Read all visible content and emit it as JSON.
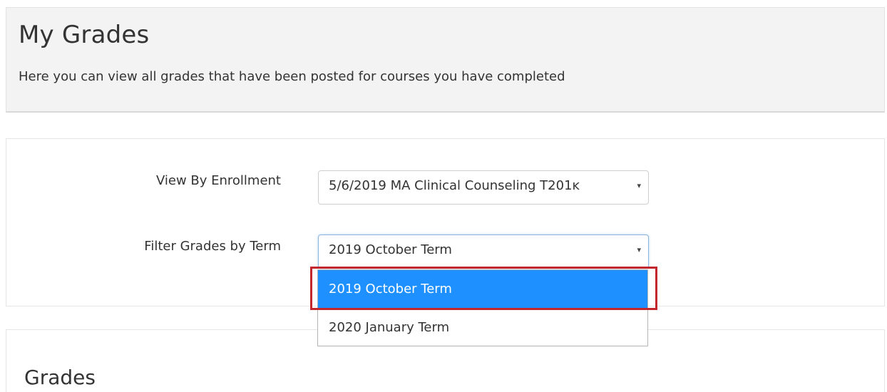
{
  "header": {
    "title": "My Grades",
    "subtitle": "Here you can view all grades that have been posted for courses you have completed"
  },
  "filters": {
    "enrollment": {
      "label": "View By Enrollment",
      "selected": "5/6/2019 MA Clinical Counseling T201ĸ"
    },
    "term": {
      "label": "Filter Grades by Term",
      "selected": "2019 October Term",
      "options": [
        "2019 October Term",
        "2020 January Term"
      ],
      "highlighted_option": "2019 October Term"
    },
    "caret_glyph": "▾"
  },
  "grades": {
    "title": "Grades"
  },
  "colors": {
    "header_bg": "#f3f3f3",
    "selected_option_bg": "#1e90ff",
    "highlight_border": "#c1272d"
  },
  "icons": {
    "dropdown_caret": "chevron-down-icon"
  }
}
